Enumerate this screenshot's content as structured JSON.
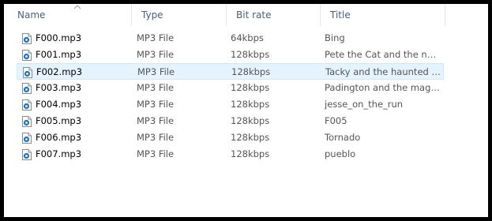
{
  "columns": {
    "name": "Name",
    "type": "Type",
    "bitrate": "Bit rate",
    "title": "Title"
  },
  "sort": {
    "column": "name",
    "direction": "ascending"
  },
  "colors": {
    "selection": "#e5f3ff",
    "header_text": "#4c607a",
    "icon_blue": "#1a73c7"
  },
  "files": [
    {
      "name": "F000.mp3",
      "type": "MP3 File",
      "bitrate": "64kbps",
      "title": "Bing"
    },
    {
      "name": "F001.mp3",
      "type": "MP3 File",
      "bitrate": "128kbps",
      "title": "Pete the Cat and the new ..."
    },
    {
      "name": "F002.mp3",
      "type": "MP3 File",
      "bitrate": "128kbps",
      "title": "Tacky and the haunted igl...",
      "selected": true
    },
    {
      "name": "F003.mp3",
      "type": "MP3 File",
      "bitrate": "128kbps",
      "title": "Padington and the magic ..."
    },
    {
      "name": "F004.mp3",
      "type": "MP3 File",
      "bitrate": "128kbps",
      "title": "jesse_on_the_run"
    },
    {
      "name": "F005.mp3",
      "type": "MP3 File",
      "bitrate": "128kbps",
      "title": "F005"
    },
    {
      "name": "F006.mp3",
      "type": "MP3 File",
      "bitrate": "128kbps",
      "title": "Tornado"
    },
    {
      "name": "F007.mp3",
      "type": "MP3 File",
      "bitrate": "128kbps",
      "title": "pueblo"
    }
  ]
}
